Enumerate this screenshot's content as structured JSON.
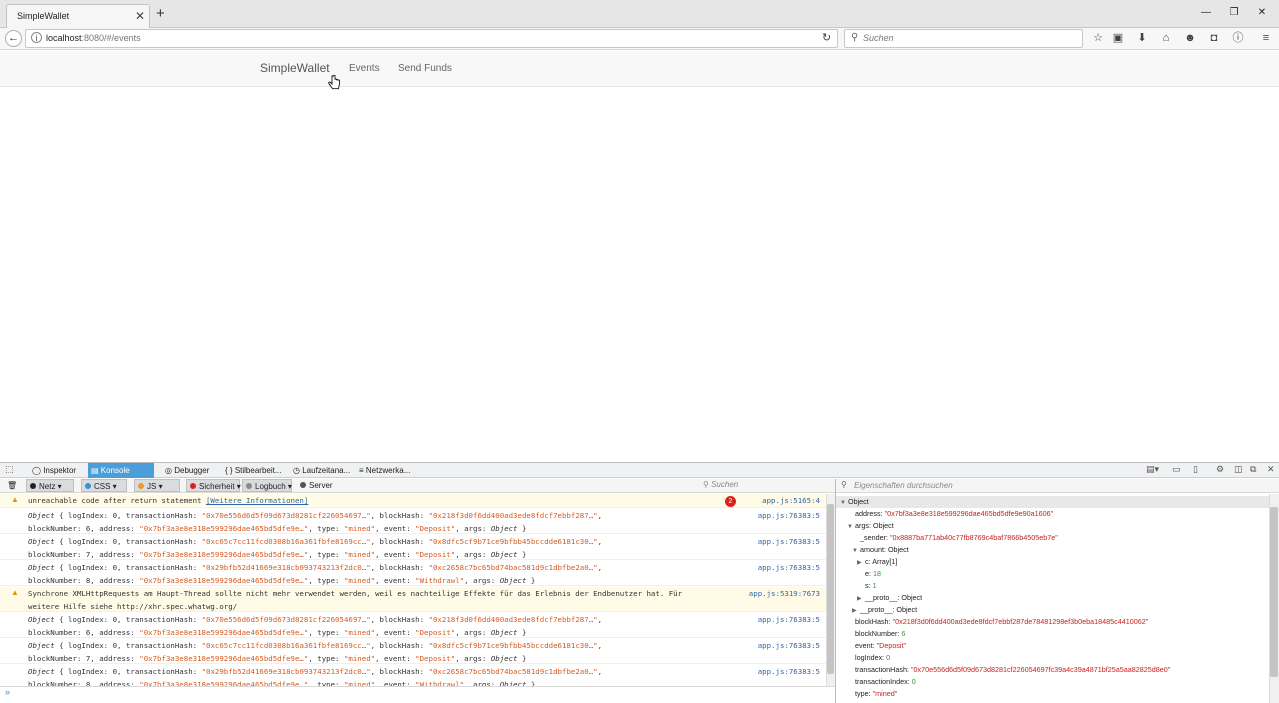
{
  "browser": {
    "tab_title": "SimpleWallet",
    "tab_close": "✕",
    "new_tab": "+",
    "window_controls": [
      "—",
      "❐",
      "✕"
    ],
    "back": "←",
    "url_host": "localhost",
    "url_rest": ":8080/#/events",
    "reload": "↻",
    "search_placeholder": "Suchen",
    "toolbar_icons": [
      "star-icon",
      "clipboard-icon",
      "download-icon",
      "home-icon",
      "chat-icon",
      "pocket-icon",
      "info-icon",
      "menu-icon"
    ],
    "toolbar_glyphs": [
      "☆",
      "▣",
      "⬇",
      "⌂",
      "☻",
      "◘",
      "ⓘ",
      "≡"
    ]
  },
  "app": {
    "brand": "SimpleWallet",
    "nav": [
      "Events",
      "Send Funds"
    ]
  },
  "devtools": {
    "tabs": [
      "Inspektor",
      "Konsole",
      "Debugger",
      "Stilbearbeit...",
      "Laufzeitana...",
      "Netzwerka..."
    ],
    "tab_glyphs": [
      "◯",
      "▤",
      "◎",
      "{ }",
      "◷",
      "≡"
    ],
    "active_tab": "Konsole",
    "filters": [
      {
        "label": "Netz",
        "color": "#222222"
      },
      {
        "label": "CSS",
        "color": "#3a8fd6"
      },
      {
        "label": "JS",
        "color": "#e99a2b"
      },
      {
        "label": "Sicherheit",
        "color": "#d8221f"
      },
      {
        "label": "Logbuch",
        "color": "#8a8a8a"
      },
      {
        "label": "Server",
        "color": "#555555"
      }
    ],
    "console_search": "Suchen",
    "vv_search": "Eigenschaften durchsuchen",
    "error_count": "2",
    "prompt": "»"
  },
  "console_rows": [
    {
      "type": "warn",
      "line1": "unreachable code after return statement ",
      "link": "[Weitere Informationen]",
      "src": "app.js:5165:4"
    },
    {
      "type": "obj",
      "idx": "0",
      "tx": "0x70e556d6d5f09d673d8281cf226054697…",
      "bh": "0x218f3d0f6dd400ad3ede8fdcf7ebbf287…",
      "bn": "6",
      "addr": "0x7bf3a3e8e318e599296dae465bd5dfe9e…",
      "t": "mined",
      "ev": "Deposit",
      "src": "app.js:76383:5"
    },
    {
      "type": "obj",
      "idx": "0",
      "tx": "0xc65c7cc11fcd0308b16a361fbfe8169cc…",
      "bh": "0x8dfc5cf9b71ce9bfbb45bccdde6181c30…",
      "bn": "7",
      "addr": "0x7bf3a3e8e318e599296dae465bd5dfe9e…",
      "t": "mined",
      "ev": "Deposit",
      "src": "app.js:76383:5"
    },
    {
      "type": "obj",
      "idx": "0",
      "tx": "0x29bfb52d41669e318cb093743213f2dc0…",
      "bh": "0xc2658c7bc65bd74bac581d9c1dbfbe2a0…",
      "bn": "8",
      "addr": "0x7bf3a3e8e318e599296dae465bd5dfe9e…",
      "t": "mined",
      "ev": "Withdrawl",
      "src": "app.js:76383:5"
    },
    {
      "type": "warn2",
      "line1": "Synchrone XMLHttpRequests am Haupt-Thread sollte nicht mehr verwendet werden, weil es nachteilige Effekte für das Erlebnis der Endbenutzer hat. Für",
      "line2": "weitere Hilfe siehe http://xhr.spec.whatwg.org/",
      "src": "app.js:5319:7673"
    },
    {
      "type": "obj",
      "idx": "0",
      "tx": "0x70e556d6d5f09d673d8281cf226054697…",
      "bh": "0x218f3d0f6dd400ad3ede8fdcf7ebbf287…",
      "bn": "6",
      "addr": "0x7bf3a3e8e318e599296dae465bd5dfe9e…",
      "t": "mined",
      "ev": "Deposit",
      "src": "app.js:76383:5"
    },
    {
      "type": "obj",
      "idx": "0",
      "tx": "0xc65c7cc11fcd0308b16a361fbfe8169cc…",
      "bh": "0x8dfc5cf9b71ce9bfbb45bccdde6181c30…",
      "bn": "7",
      "addr": "0x7bf3a3e8e318e599296dae465bd5dfe9e…",
      "t": "mined",
      "ev": "Deposit",
      "src": "app.js:76383:5"
    },
    {
      "type": "obj",
      "idx": "0",
      "tx": "0x29bfb52d41669e318cb093743213f2dc0…",
      "bh": "0xc2658c7bc65bd74bac581d9c1dbfbe2a0…",
      "bn": "8",
      "addr": "0x7bf3a3e8e318e599296dae465bd5dfe9e…",
      "t": "mined",
      "ev": "Withdrawl",
      "src": "app.js:76383:5"
    }
  ],
  "variables": [
    {
      "depth": 0,
      "tri": "▼",
      "key": "Object",
      "val": "",
      "kind": "head"
    },
    {
      "depth": 1,
      "tri": "",
      "key": "address: ",
      "val": "\"0x7bf3a3e8e318e599296dae465bd5dfe9e90a1606\"",
      "kind": "str"
    },
    {
      "depth": 1,
      "tri": "▼",
      "key": "args: ",
      "val": "Object",
      "kind": "plain"
    },
    {
      "depth": 2,
      "tri": "",
      "key": "_sender: ",
      "val": "\"0x8887ba771ab40c77fb8769c4baf7866b4505eb7e\"",
      "kind": "str"
    },
    {
      "depth": 2,
      "tri": "▼",
      "key": "amount: ",
      "val": "Object",
      "kind": "plain"
    },
    {
      "depth": 3,
      "tri": "▶",
      "key": "c: ",
      "val": "Array[1]",
      "kind": "plain"
    },
    {
      "depth": 3,
      "tri": "",
      "key": "e: ",
      "val": "18",
      "kind": "num"
    },
    {
      "depth": 3,
      "tri": "",
      "key": "s: ",
      "val": "1",
      "kind": "num"
    },
    {
      "depth": 3,
      "tri": "▶",
      "key": "__proto__: ",
      "val": "Object",
      "kind": "plain"
    },
    {
      "depth": 2,
      "tri": "▶",
      "key": "__proto__: ",
      "val": "Object",
      "kind": "plain"
    },
    {
      "depth": 1,
      "tri": "",
      "key": "blockHash: ",
      "val": "\"0x218f3d0f6dd400ad3ede8fdcf7ebbf287de78481298ef3b0eba18485c4410062\"",
      "kind": "str"
    },
    {
      "depth": 1,
      "tri": "",
      "key": "blockNumber: ",
      "val": "6",
      "kind": "num"
    },
    {
      "depth": 1,
      "tri": "",
      "key": "event: ",
      "val": "\"Deposit\"",
      "kind": "str"
    },
    {
      "depth": 1,
      "tri": "",
      "key": "logIndex: ",
      "val": "0",
      "kind": "num"
    },
    {
      "depth": 1,
      "tri": "",
      "key": "transactionHash: ",
      "val": "\"0x70e556d6d5f09d673d8281cf226054697fc39a4c39a4871bf25a5aa82825d8e0\"",
      "kind": "str"
    },
    {
      "depth": 1,
      "tri": "",
      "key": "transactionIndex: ",
      "val": "0",
      "kind": "num"
    },
    {
      "depth": 1,
      "tri": "",
      "key": "type: ",
      "val": "\"mined\"",
      "kind": "str"
    }
  ]
}
